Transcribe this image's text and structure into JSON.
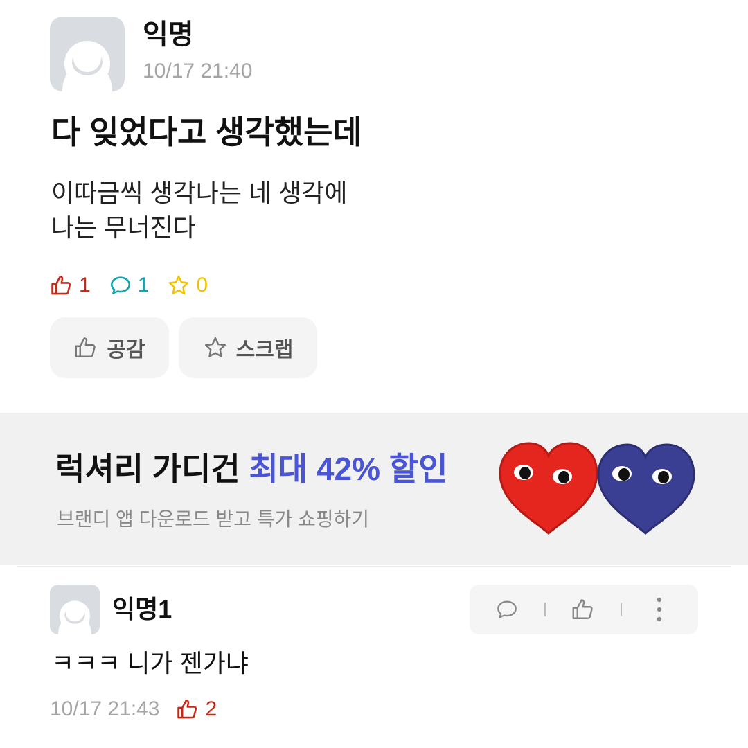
{
  "post": {
    "author": "익명",
    "timestamp": "10/17 21:40",
    "title": "다 잊었다고 생각했는데",
    "body_lines": [
      "이따금씩 생각나는 네 생각에",
      "나는 무너진다"
    ],
    "stats": {
      "likes": "1",
      "comments": "1",
      "scraps": "0"
    },
    "actions": {
      "like_label": "공감",
      "scrap_label": "스크랩"
    }
  },
  "banner": {
    "title_main": "럭셔리 가디건",
    "title_accent": "최대 42% 할인",
    "subtitle": "브랜디 앱 다운로드 받고 특가 쇼핑하기"
  },
  "comment": {
    "author": "익명1",
    "text": "ㅋㅋㅋ 니가 젠가냐",
    "timestamp": "10/17 21:43",
    "likes": "2"
  },
  "colors": {
    "like_red": "#c62917",
    "comment_teal": "#0fa3b1",
    "scrap_yellow": "#f2c200",
    "banner_accent": "#4a55d6"
  },
  "icons": {
    "avatar": "anonymous-avatar-icon",
    "like": "thumbs-up-icon",
    "comment": "speech-bubble-icon",
    "scrap": "star-icon",
    "more": "more-vertical-icon"
  }
}
